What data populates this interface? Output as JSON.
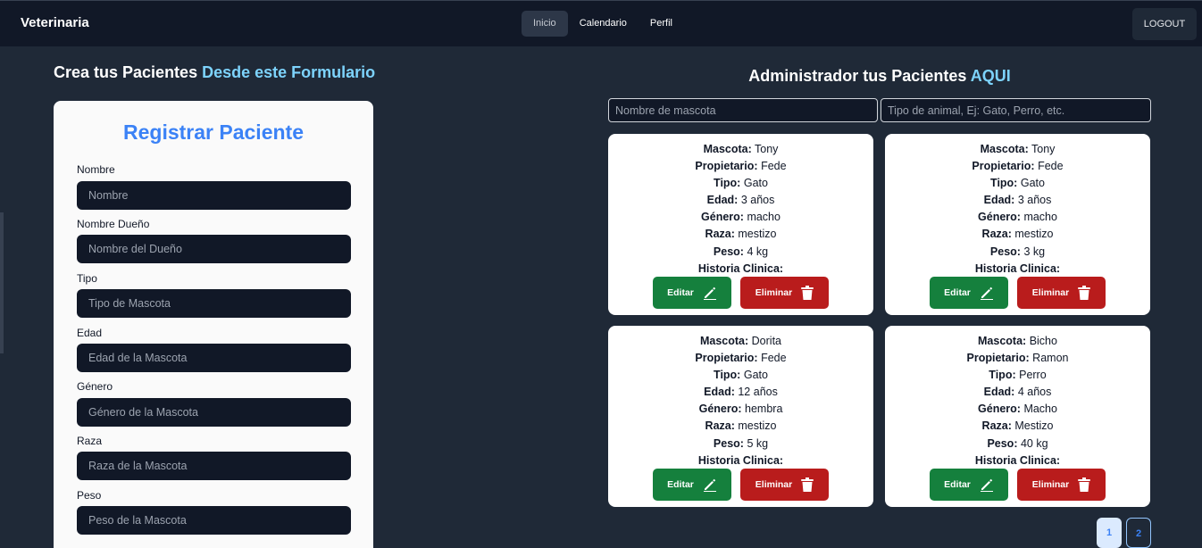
{
  "navbar": {
    "brand": "Veterinaria",
    "links": [
      {
        "label": "Inicio",
        "active": true
      },
      {
        "label": "Calendario",
        "active": false
      },
      {
        "label": "Perfil",
        "active": false
      }
    ],
    "logout": "LOGOUT"
  },
  "form_section": {
    "heading_prefix": "Crea tus Pacientes",
    "heading_highlight": "Desde este Formulario",
    "title": "Registrar Paciente",
    "fields": [
      {
        "label": "Nombre",
        "placeholder": "Nombre"
      },
      {
        "label": "Nombre Dueño",
        "placeholder": "Nombre del Dueño"
      },
      {
        "label": "Tipo",
        "placeholder": "Tipo de Mascota"
      },
      {
        "label": "Edad",
        "placeholder": "Edad de la Mascota"
      },
      {
        "label": "Género",
        "placeholder": "Género de la Mascota"
      },
      {
        "label": "Raza",
        "placeholder": "Raza de la Mascota"
      },
      {
        "label": "Peso",
        "placeholder": "Peso de la Mascota"
      }
    ]
  },
  "admin_section": {
    "heading_prefix": "Administrador tus Pacientes",
    "heading_highlight": "AQUI",
    "search_name_placeholder": "Nombre de mascota",
    "search_type_placeholder": "Tipo de animal, Ej: Gato, Perro, etc.",
    "field_labels": {
      "mascota": "Mascota:",
      "propietario": "Propietario:",
      "tipo": "Tipo:",
      "edad": "Edad:",
      "genero": "Género:",
      "raza": "Raza:",
      "peso": "Peso:",
      "historia": "Historia Clinica:"
    },
    "edit_label": "Editar",
    "delete_label": "Eliminar",
    "patients": [
      {
        "mascota": "Tony",
        "propietario": "Fede",
        "tipo": "Gato",
        "edad": "3 años",
        "genero": "macho",
        "raza": "mestizo",
        "peso": "4 kg",
        "historia": ""
      },
      {
        "mascota": "Tony",
        "propietario": "Fede",
        "tipo": "Gato",
        "edad": "3 años",
        "genero": "macho",
        "raza": "mestizo",
        "peso": "3 kg",
        "historia": ""
      },
      {
        "mascota": "Dorita",
        "propietario": "Fede",
        "tipo": "Gato",
        "edad": "12 años",
        "genero": "hembra",
        "raza": "mestizo",
        "peso": "5 kg",
        "historia": ""
      },
      {
        "mascota": "Bicho",
        "propietario": "Ramon",
        "tipo": "Perro",
        "edad": "4 años",
        "genero": "Macho",
        "raza": "Mestizo",
        "peso": "40 kg",
        "historia": ""
      }
    ],
    "pagination": [
      "1",
      "2"
    ],
    "current_page": "1"
  },
  "colors": {
    "background": "#1f2937",
    "navbar": "#111827",
    "accent_blue": "#3b82f6",
    "highlight": "#7dd3fc",
    "edit_green": "#15803d",
    "delete_red": "#b91c1c"
  }
}
